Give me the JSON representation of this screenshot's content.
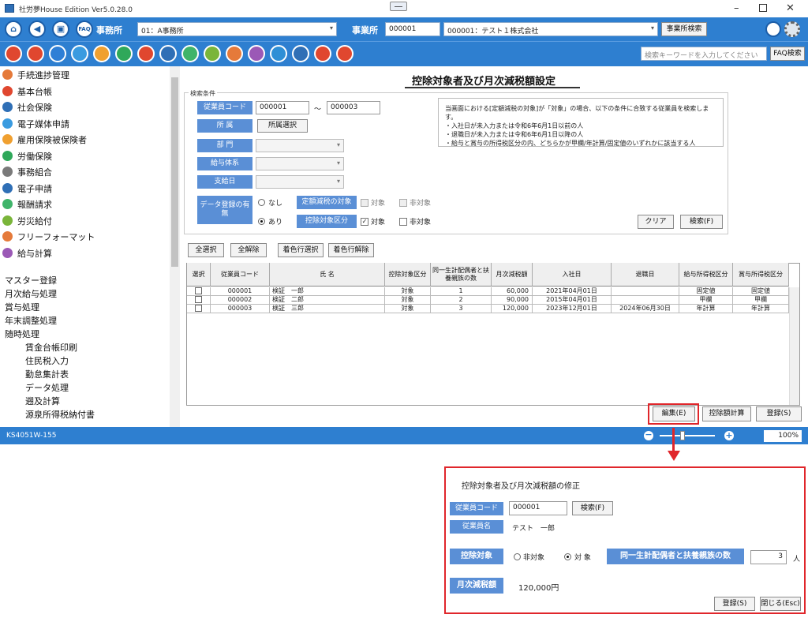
{
  "window": {
    "title": "社労夢House Edition Ver5.0.28.0"
  },
  "toolbar1": {
    "office_label": "事務所",
    "office_combo": "01：A事務所",
    "business_label": "事業所",
    "business_code": "000001",
    "business_combo": "000001：テスト１株式会社",
    "business_search_button": "事業所検索",
    "home_icon": "home-icon",
    "back_icon": "back-icon",
    "menu_icon": "menu-icon",
    "faq_icon": "faq-icon"
  },
  "toolbar2": {
    "search_placeholder": "検索キーワードを入力してください",
    "faq_search_button": "FAQ検索",
    "tools": [
      "#e0472f",
      "#e0472f",
      "#2f7fd6",
      "#3a9be0",
      "#f0a030",
      "#2fa85a",
      "#e0472f",
      "#2f6fb6",
      "#3fb46a",
      "#7ab53a",
      "#e57a3a",
      "#9b59b6",
      "#2f8fd6",
      "#2f6fb6",
      "#e0472f",
      "#e0472f"
    ]
  },
  "sidebar": {
    "items": [
      {
        "label": "手続進捗管理",
        "color": "#e57a3a"
      },
      {
        "label": "基本台帳",
        "color": "#e0472f"
      },
      {
        "label": "社会保険",
        "color": "#2f6fb6"
      },
      {
        "label": "電子媒体申請",
        "color": "#3a9be0"
      },
      {
        "label": "雇用保険被保険者",
        "color": "#f0a030"
      },
      {
        "label": "労働保険",
        "color": "#2fa85a"
      },
      {
        "label": "事務組合",
        "color": "#7a7a7a"
      },
      {
        "label": "電子申請",
        "color": "#2f6fb6"
      },
      {
        "label": "報酬請求",
        "color": "#3fb46a"
      },
      {
        "label": "労災給付",
        "color": "#7ab53a"
      },
      {
        "label": "フリーフォーマット",
        "color": "#e57a3a"
      },
      {
        "label": "給与計算",
        "color": "#9b59b6"
      }
    ],
    "sub": [
      "マスター登録",
      "月次給与処理",
      "賞与処理",
      "年末調整処理",
      "随時処理"
    ],
    "sub2": [
      "賃金台帳印刷",
      "住民税入力",
      "勤怠集計表",
      "データ処理",
      "遡及計算",
      "源泉所得税納付書"
    ]
  },
  "main": {
    "title": "控除対象者及び月次減税額設定",
    "group_label": "検索条件",
    "employee_code_label": "従業員コード",
    "emp_from": "000001",
    "tilde": "〜",
    "emp_to": "000003",
    "affiliation_label": "所 属",
    "affiliation_button": "所属選択",
    "dept_label": "部 門",
    "pay_system_label": "給与体系",
    "pay_day_label": "支給日",
    "data_reg_label": "データ登録の有無",
    "radio_none": "なし",
    "radio_exists": "あり",
    "target_label": "定額減税の対象",
    "target_yes": "対象",
    "target_no": "非対象",
    "deduct_label": "控除対象区分",
    "deduct_yes": "対象",
    "deduct_no": "非対象",
    "notice": [
      "当画面における[定額減税の対象]が「対象」の場合、以下の条件に合致する従業員を検索します。",
      "・入社日が未入力または令和6年6月1日以前の人",
      "・退職日が未入力または令和6年6月1日以降の人",
      "・給与と賞与の所得税区分の内、どちらかが甲欄/年計算/固定値のいずれかに該当する人"
    ],
    "clear_button": "クリア",
    "search_button": "検索(F)",
    "select_all": "全選択",
    "deselect_all": "全解除",
    "color_select": "着色行選択",
    "color_clear": "着色行解除",
    "table": {
      "headers": [
        "選択",
        "従業員コード",
        "氏 名",
        "控除対象区分",
        "同一生計配偶者と扶養親族の数",
        "月次減税額",
        "入社日",
        "退職日",
        "給与所得税区分",
        "賞与所得税区分"
      ],
      "rows": [
        [
          "",
          "000001",
          "検証　一郎",
          "対象",
          "1",
          "60,000",
          "2021年04月01日",
          "",
          "固定値",
          "固定値"
        ],
        [
          "",
          "000002",
          "検証　二郎",
          "対象",
          "2",
          "90,000",
          "2015年04月01日",
          "",
          "甲欄",
          "甲欄"
        ],
        [
          "",
          "000003",
          "検証　三郎",
          "対象",
          "3",
          "120,000",
          "2023年12月01日",
          "2024年06月30日",
          "年計算",
          "年計算"
        ]
      ]
    },
    "edit_button": "編集(E)",
    "calc_button": "控除額計算",
    "register_button": "登録(S)"
  },
  "status": {
    "screen_id": "KS4051W-155",
    "zoom": "100%",
    "zoom_level": 0.42
  },
  "dialog": {
    "title": "控除対象者及び月次減税額の修正",
    "emp_code_label": "従業員コード",
    "emp_code": "000001",
    "search_button": "検索(F)",
    "emp_name_label": "従業員名",
    "emp_name": "テスト　一郎",
    "deduct_label": "控除対象",
    "opt_no": "非対象",
    "opt_yes": "対 象",
    "dependents_label": "同一生計配偶者と扶養親族の数",
    "dependents": "3",
    "unit": "人",
    "monthly_label": "月次減税額",
    "monthly_value": "120,000円",
    "register_button": "登録(S)",
    "close_button": "閉じる(Esc)"
  }
}
